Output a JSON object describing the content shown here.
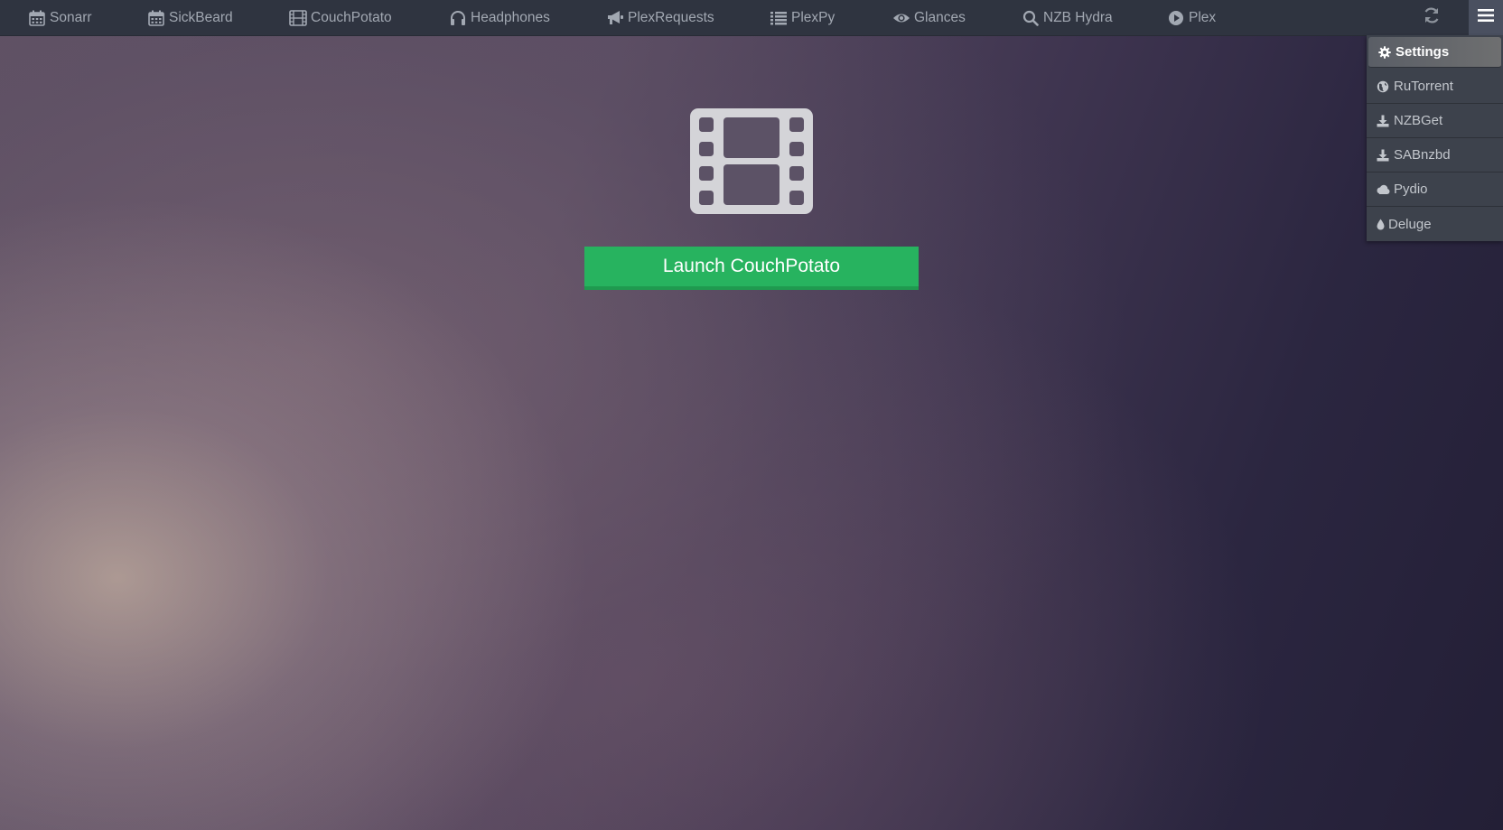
{
  "nav": {
    "items": [
      {
        "label": "Sonarr",
        "icon": "calendar-icon"
      },
      {
        "label": "SickBeard",
        "icon": "calendar-icon"
      },
      {
        "label": "CouchPotato",
        "icon": "film-icon"
      },
      {
        "label": "Headphones",
        "icon": "headphones-icon"
      },
      {
        "label": "PlexRequests",
        "icon": "bullhorn-icon"
      },
      {
        "label": "PlexPy",
        "icon": "list-icon"
      },
      {
        "label": "Glances",
        "icon": "eye-icon"
      },
      {
        "label": "NZB Hydra",
        "icon": "search-icon"
      },
      {
        "label": "Plex",
        "icon": "play-circle-icon"
      }
    ],
    "refresh_icon": "refresh-icon",
    "menu_icon": "hamburger-menu-icon"
  },
  "dropdown": {
    "items": [
      {
        "label": "Settings",
        "icon": "gear-icon",
        "active": true
      },
      {
        "label": "RuTorrent",
        "icon": "globe-icon",
        "active": false
      },
      {
        "label": "NZBGet",
        "icon": "download-icon",
        "active": false
      },
      {
        "label": "SABnzbd",
        "icon": "download-icon",
        "active": false
      },
      {
        "label": "Pydio",
        "icon": "cloud-icon",
        "active": false
      },
      {
        "label": "Deluge",
        "icon": "droplet-icon",
        "active": false
      }
    ]
  },
  "main": {
    "app_icon": "film-icon",
    "launch_label": "Launch CouchPotato"
  },
  "colors": {
    "topbar": "#2f3440",
    "nav_text": "#a2a8b2",
    "launch_button": "#27b35f",
    "dropdown_bg": "#3d424c"
  }
}
